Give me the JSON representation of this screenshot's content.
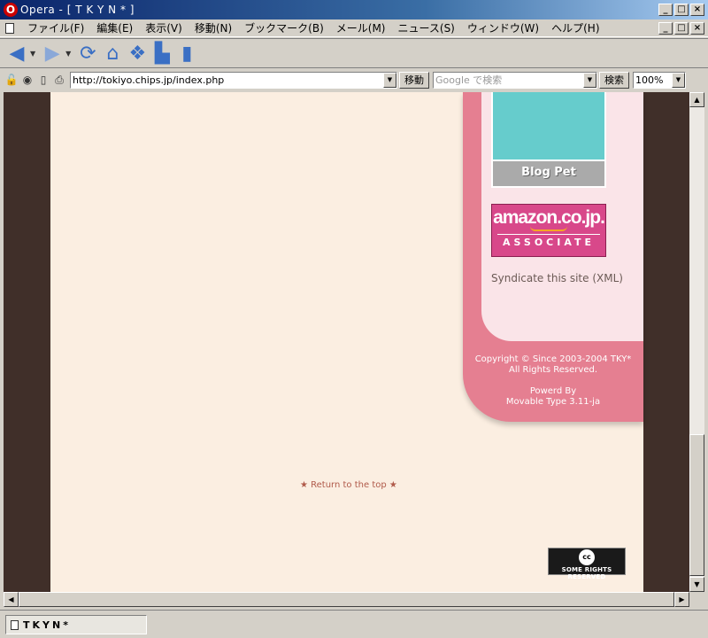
{
  "window": {
    "title": "Opera - [ T K Y N * ]",
    "buttons": [
      "_",
      "□",
      "×"
    ]
  },
  "menu": {
    "items": [
      "ファイル(F)",
      "編集(E)",
      "表示(V)",
      "移動(N)",
      "ブックマーク(B)",
      "メール(M)",
      "ニュース(S)",
      "ウィンドウ(W)",
      "ヘルプ(H)"
    ]
  },
  "toolbar": {
    "icons": [
      "back-icon",
      "forward-icon",
      "reload-icon",
      "home-icon",
      "hotlist-icon",
      "print-icon",
      "new-page-icon"
    ]
  },
  "addressbar": {
    "url": "http://tokiyo.chips.jp/index.php",
    "go_label": "移動",
    "search_placeholder": "Google で検索",
    "search_label": "検索",
    "zoom": "100%"
  },
  "page": {
    "blogpet_label": "Blog Pet",
    "amazon_brand": "amazon.co.jp.",
    "amazon_assoc": "ASSOCIATE",
    "syndicate": "Syndicate this site (XML)",
    "copyright_line1": "Copyright © Since 2003-2004 TKY*",
    "copyright_line2": "All Rights Reserved.",
    "powered_line1": "Powerd By",
    "powered_line2": "Movable Type 3.11-ja",
    "return_top": "★ Return to the top ★",
    "cc_symbol": "cc",
    "cc_text": "SOME RIGHTS RESERVED"
  },
  "status": {
    "tab_title": "TKYN*"
  },
  "colors": {
    "frame": "#402f29",
    "page_bg": "#fbeee1",
    "sidebar_pink": "#e57f91",
    "sidebar_light": "#fae4e8",
    "blogpet_teal": "#66cccc",
    "amazon_pink": "#d8488a"
  }
}
